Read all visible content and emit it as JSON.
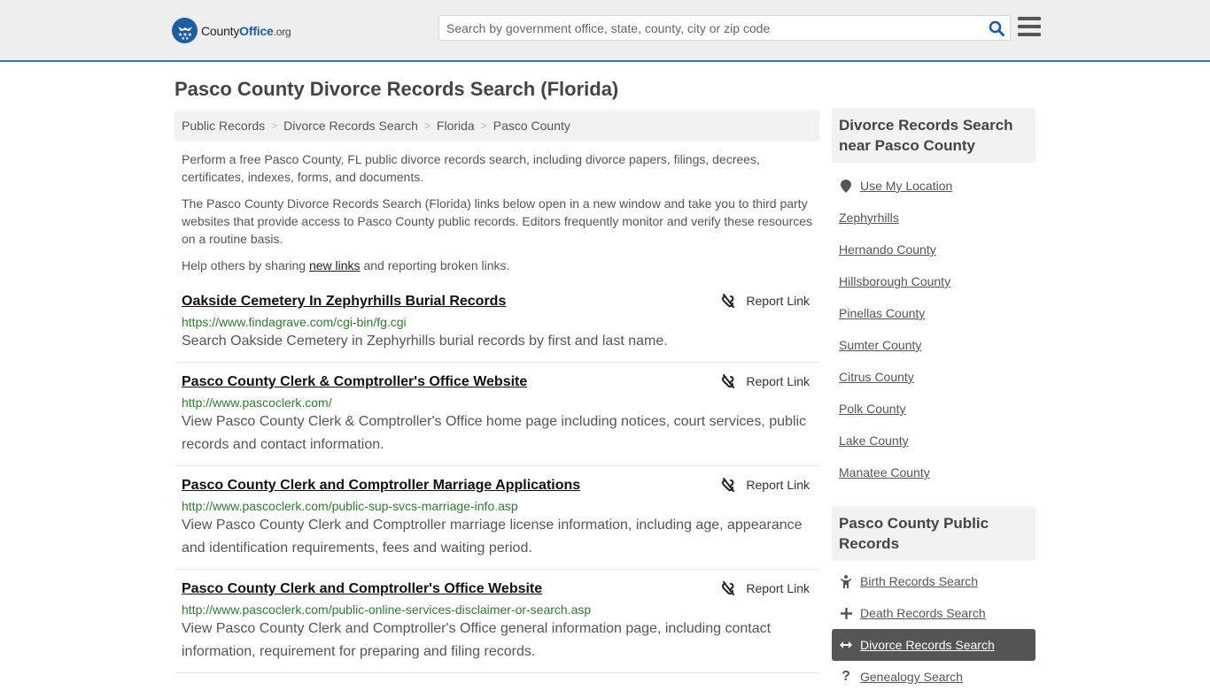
{
  "header": {
    "logo": {
      "county": "County",
      "office": "Office",
      "org": ".org",
      "icon": "eagle-stars-badge-icon"
    },
    "search": {
      "placeholder": "Search by government office, state, county, city or zip code",
      "value": "",
      "icon": "search-icon"
    },
    "menu_icon": "hamburger-menu-icon"
  },
  "page": {
    "title": "Pasco County Divorce Records Search (Florida)",
    "breadcrumb": [
      "Public Records",
      "Divorce Records Search",
      "Florida",
      "Pasco County"
    ],
    "intro": {
      "p1": "Perform a free Pasco County, FL public divorce records search, including divorce papers, filings, decrees, certificates, indexes, forms, and documents.",
      "p2": "The Pasco County Divorce Records Search (Florida) links below open in a new window and take you to third party websites that provide access to Pasco County public records. Editors frequently monitor and verify these resources on a routine basis.",
      "p3_before": "Help others by sharing ",
      "p3_link": "new links",
      "p3_after": " and reporting broken links."
    }
  },
  "results": [
    {
      "title": "Oakside Cemetery In Zephyrhills Burial Records",
      "url": "https://www.findagrave.com/cgi-bin/fg.cgi",
      "description": "Search Oakside Cemetery in Zephyrhills burial records by first and last name.",
      "report_label": "Report Link"
    },
    {
      "title": "Pasco County Clerk & Comptroller's Office Website",
      "url": "http://www.pascoclerk.com/",
      "description": "View Pasco County Clerk & Comptroller's Office home page including notices, court services, public records and contact information.",
      "report_label": "Report Link"
    },
    {
      "title": "Pasco County Clerk and Comptroller Marriage Applications",
      "url": "http://www.pascoclerk.com/public-sup-svcs-marriage-info.asp",
      "description": "View Pasco County Clerk and Comptroller marriage license information, including age, appearance and identification requirements, fees and waiting period.",
      "report_label": "Report Link"
    },
    {
      "title": "Pasco County Clerk and Comptroller's Office Website",
      "url": "http://www.pascoclerk.com/public-online-services-disclaimer-or-search.asp",
      "description": "View Pasco County Clerk and Comptroller's Office general information page, including contact information, requirement for preparing and filing records.",
      "report_label": "Report Link"
    }
  ],
  "sidebar": {
    "nearby": {
      "heading": "Divorce Records Search near Pasco County",
      "use_location": "Use My Location",
      "items": [
        "Zephyrhills",
        "Hernando County",
        "Hillsborough County",
        "Pinellas County",
        "Sumter County",
        "Citrus County",
        "Polk County",
        "Lake County",
        "Manatee County"
      ]
    },
    "public_records": {
      "heading": "Pasco County Public Records",
      "items": [
        {
          "label": "Birth Records Search",
          "icon": "child-icon",
          "active": false
        },
        {
          "label": "Death Records Search",
          "icon": "plus-icon",
          "active": false
        },
        {
          "label": "Divorce Records Search",
          "icon": "arrows-horizontal-icon",
          "active": true
        },
        {
          "label": "Genealogy Search",
          "icon": "question-icon",
          "active": false
        }
      ]
    }
  },
  "colors": {
    "brand_blue": "#1d5ea3",
    "header_border": "#3b77a8",
    "url_green": "#2d7d2d",
    "active_bg": "#555555"
  }
}
